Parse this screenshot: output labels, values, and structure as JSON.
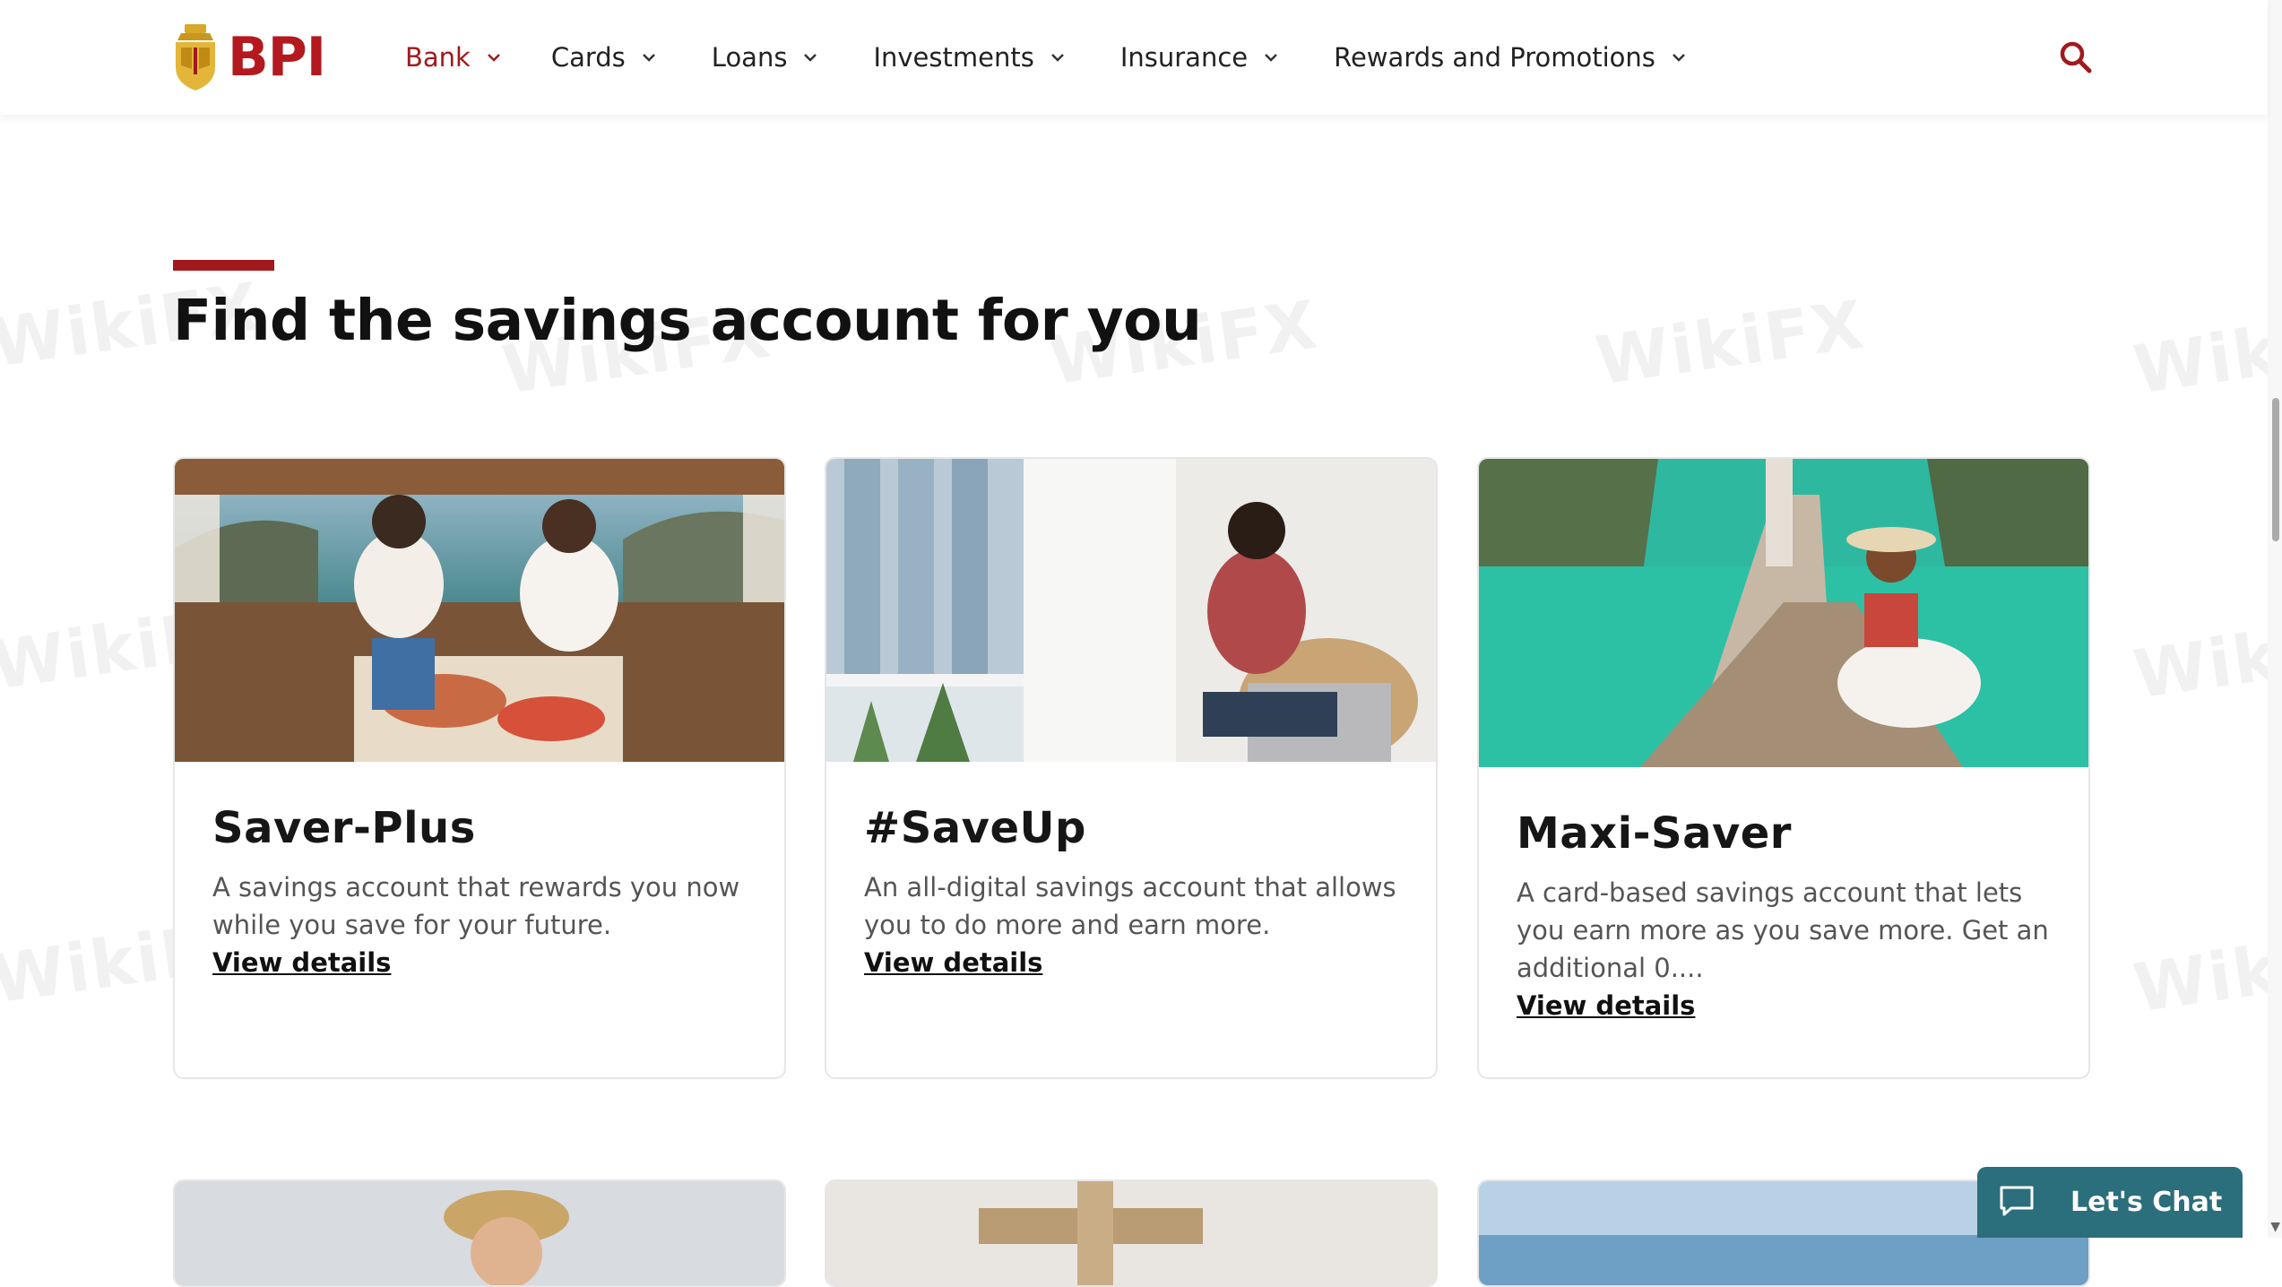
{
  "brand": {
    "logo_text": "BPI",
    "accent": "#a01a1e"
  },
  "nav": {
    "items": [
      {
        "label": "Bank",
        "active": true
      },
      {
        "label": "Cards"
      },
      {
        "label": "Loans"
      },
      {
        "label": "Investments"
      },
      {
        "label": "Insurance"
      },
      {
        "label": "Rewards and Promotions"
      }
    ],
    "search_icon": "search-icon"
  },
  "section": {
    "title": "Find the savings account for you"
  },
  "cards": [
    {
      "title": "Saver-Plus",
      "description": "A savings account that rewards you now while you save for your future.",
      "link": "View details",
      "image": "couple-toasting-on-boat-photo"
    },
    {
      "title": "#SaveUp",
      "description": "An all-digital savings account that allows you to do more and earn more.",
      "link": "View details",
      "image": "man-with-coffee-by-window-photo"
    },
    {
      "title": "Maxi-Saver",
      "description": "A card-based savings account that lets you earn more as you save more. Get an additional 0....",
      "link": "View details",
      "image": "woman-on-longtail-boat-photo"
    }
  ],
  "chat": {
    "label": "Let's Chat",
    "color": "#2b6e7c"
  },
  "watermark": {
    "text": "WikiFX"
  }
}
